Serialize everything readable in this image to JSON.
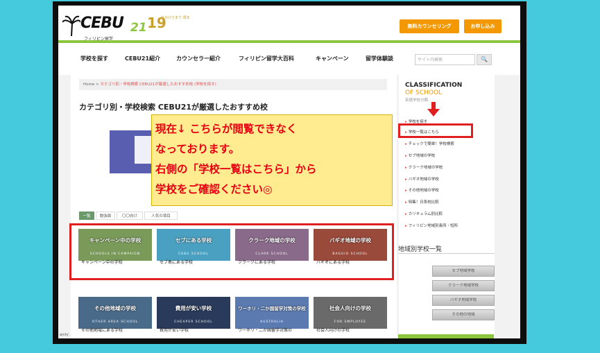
{
  "logo": {
    "brand": "CEBU",
    "num": "21",
    "sub": "フィリピン留学",
    "anniv": "19",
    "anniv_sub": "おかげさまで 周年"
  },
  "header_buttons": {
    "counseling": "無料カウンセリング",
    "apply": "お申し込み"
  },
  "nav": [
    "学校を探す",
    "CEBU21紹介",
    "カウンセラー紹介",
    "フィリピン留学大百科",
    "キャンペーン",
    "留学体験談"
  ],
  "search": {
    "placeholder": "サイト内検索",
    "button": "🔍"
  },
  "breadcrumb": {
    "home": "Home",
    "sep": " > ",
    "current": "カテゴリ別・学校検索 CEBU21が厳選したおすすめ校 (学校を探す)"
  },
  "page_title": "カテゴリ別・学校検索 CEBU21が厳選したおすすめ校",
  "overlay": {
    "line1": "現在↓ こちらが閲覧できなく",
    "line2": "なっております。",
    "line3": "右側の「学校一覧はこちら」から",
    "line4": "学校をご確認ください◎"
  },
  "tabs": [
    "一覧",
    "勉強面",
    "〇〇向け",
    "人気の項目"
  ],
  "cards_row1": [
    {
      "img": "キャンペーン中の学校",
      "sub": "SCHOOLS IN CAMPAIGN",
      "label": "キャンペーン中の学校",
      "color": "#7a9a5a"
    },
    {
      "img": "セブにある学校",
      "sub": "CEBU SCHOOL",
      "label": "セブ島にある学校",
      "color": "#4aa0c0"
    },
    {
      "img": "クラーク地域の学校",
      "sub": "CLARK SCHOOL",
      "label": "クラークにある学校",
      "color": "#8a6a8a"
    },
    {
      "img": "バギオ地域の学校",
      "sub": "BAGUIO SCHOOL",
      "label": "バギオにある学校",
      "color": "#9a4a3a"
    }
  ],
  "cards_row2": [
    {
      "img": "その他地域の学校",
      "sub": "OTHER AREA SCHOOL",
      "label": "その他地域にある学校",
      "color": "#4a6a8a"
    },
    {
      "img": "費用が安い学校",
      "sub": "CHEAPER SCHOOL",
      "label": "費用が安い学校",
      "color": "#2a3a5a"
    },
    {
      "img": "ワーホリ・二か国留学対策の学校",
      "sub": "AUSTRALIA",
      "label": "ワーホリ・二か国留学対策の",
      "color": "#5a7ab0"
    },
    {
      "img": "社会人向けの学校",
      "sub": "FOR EMPLOYEE",
      "label": "社会人向けの学校",
      "color": "#6a6a6a"
    }
  ],
  "sidebar": {
    "head1": "CLASSIFICATION",
    "head2": "OF SCHOOL",
    "head3": "英語学校分類",
    "links": [
      "学校を探す",
      "学校一覧はこちら",
      "チェックで簡単！学校検索",
      "セブ地域の学校",
      "クラーク地域の学校",
      "バギオ地域の学校",
      "その他地域の学校",
      "特集！日系校比較",
      "カリキュラム別比較",
      "フィリピン地域別長所・短所"
    ],
    "section": "地域別学校一覧",
    "region_buttons": [
      "セブ地域学校",
      "クラーク地域学校",
      "バギオ地域学校",
      "その他の地域"
    ]
  },
  "status_text": "arch/",
  "colors": {
    "accent": "#8cc63f",
    "orange": "#f39800",
    "red": "#e02020",
    "bg": "#44c9dd"
  }
}
